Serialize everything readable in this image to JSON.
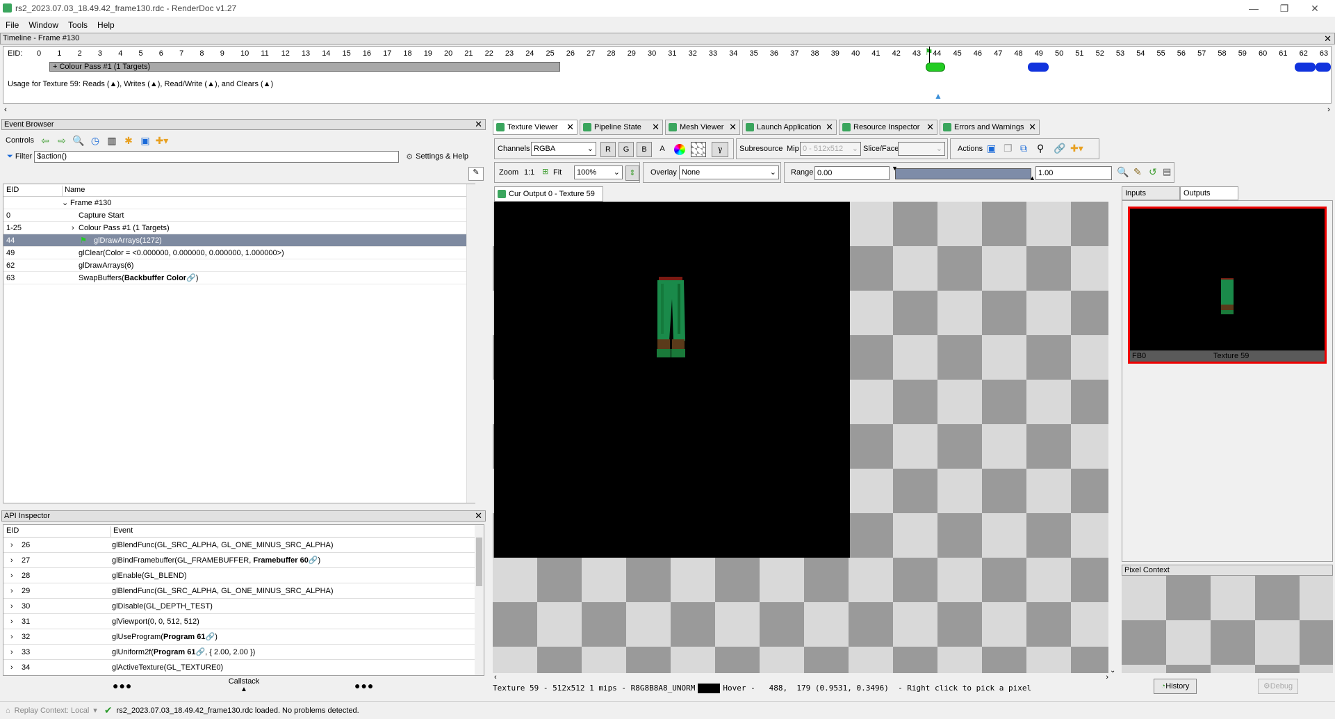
{
  "window": {
    "title": "rs2_2023.07.03_18.49.42_frame130.rdc - RenderDoc v1.27",
    "controls": [
      "—",
      "❐",
      "✕"
    ]
  },
  "menu": [
    "File",
    "Window",
    "Tools",
    "Help"
  ],
  "timeline": {
    "title": "Timeline - Frame #130",
    "eid_label": "EID:",
    "ticks": [
      "0",
      "1",
      "2",
      "3",
      "4",
      "5",
      "6",
      "7",
      "8",
      "9",
      "10",
      "11",
      "12",
      "13",
      "14",
      "15",
      "16",
      "17",
      "18",
      "19",
      "20",
      "21",
      "22",
      "23",
      "24",
      "25",
      "26",
      "27",
      "28",
      "29",
      "30",
      "31",
      "32",
      "33",
      "34",
      "35",
      "36",
      "37",
      "38",
      "39",
      "40",
      "41",
      "42",
      "43",
      "44",
      "45",
      "46",
      "47",
      "48",
      "49",
      "50",
      "51",
      "52",
      "53",
      "54",
      "55",
      "56",
      "57",
      "58",
      "59",
      "60",
      "61",
      "62",
      "63"
    ],
    "current_eid": "44",
    "pass_label": "+ Colour Pass #1 (1 Targets)",
    "usage_text": "Usage for Texture 59: Reads (▲), Writes (▲), Read/Write (▲), and Clears (▲)",
    "colors": {
      "current": "#22cc22",
      "usage": "#1133dd",
      "read": "#ddcc00"
    }
  },
  "event_browser": {
    "title": "Event Browser",
    "controls_label": "Controls",
    "filter_label": "Filter",
    "filter_value": "$action()",
    "settings_label": "Settings & Help",
    "col_eid": "EID",
    "col_name": "Name",
    "rows": [
      {
        "eid": "",
        "name": "Frame #130"
      },
      {
        "eid": "0",
        "name": "Capture Start"
      },
      {
        "eid": "1-25",
        "name": "Colour Pass #1 (1 Targets)"
      },
      {
        "eid": "44",
        "name": "glDrawArrays(1272)"
      },
      {
        "eid": "49",
        "name": "glClear(Color = <0.000000, 0.000000, 0.000000, 1.000000>)"
      },
      {
        "eid": "62",
        "name": "glDrawArrays(6)"
      },
      {
        "eid": "63",
        "name": "SwapBuffers(",
        "bold": "Backbuffer Color"
      }
    ]
  },
  "api_inspector": {
    "title": "API Inspector",
    "col_eid": "EID",
    "col_event": "Event",
    "callstack_label": "Callstack",
    "rows": [
      {
        "eid": "26",
        "event": "glBlendFunc(GL_SRC_ALPHA, GL_ONE_MINUS_SRC_ALPHA)"
      },
      {
        "eid": "27",
        "event": "glBindFramebuffer(GL_FRAMEBUFFER, ",
        "bold": "Framebuffer 60",
        "tail": ")"
      },
      {
        "eid": "28",
        "event": "glEnable(GL_BLEND)"
      },
      {
        "eid": "29",
        "event": "glBlendFunc(GL_SRC_ALPHA, GL_ONE_MINUS_SRC_ALPHA)"
      },
      {
        "eid": "30",
        "event": "glDisable(GL_DEPTH_TEST)"
      },
      {
        "eid": "31",
        "event": "glViewport(0, 0, 512, 512)"
      },
      {
        "eid": "32",
        "event": "glUseProgram(",
        "bold": "Program 61",
        "tail": ")"
      },
      {
        "eid": "33",
        "event": "glUniform2f(",
        "bold": "Program 61",
        "tail": ", { 2.00, 2.00 })"
      },
      {
        "eid": "34",
        "event": "glActiveTexture(GL_TEXTURE0)"
      }
    ]
  },
  "tabs": [
    {
      "label": "Texture Viewer",
      "active": true
    },
    {
      "label": "Pipeline State"
    },
    {
      "label": "Mesh Viewer"
    },
    {
      "label": "Launch Application"
    },
    {
      "label": "Resource Inspector"
    },
    {
      "label": "Errors and Warnings"
    }
  ],
  "texture_viewer": {
    "channels_label": "Channels",
    "channels_value": "RGBA",
    "channel_buttons": [
      "R",
      "G",
      "B",
      "A"
    ],
    "gamma_label": "γ",
    "subresource_label": "Subresource",
    "mip_label": "Mip",
    "mip_value": "0 - 512x512",
    "slice_label": "Slice/Face",
    "actions_label": "Actions",
    "zoom_label": "Zoom",
    "zoom_1to1": "1:1",
    "fit_label": "Fit",
    "zoom_value": "100%",
    "overlay_label": "Overlay",
    "overlay_value": "None",
    "range_label": "Range",
    "range_min": "0.00",
    "range_max": "1.00",
    "output_tab": "Cur Output 0 - Texture 59",
    "status": "Texture 59 - 512x512 1 mips - R8G8B8A8_UNORM",
    "hover": "Hover -   488,  179 (0.9531, 0.3496)  - Right click to pick a pixel"
  },
  "right_panel": {
    "tab_inputs": "Inputs",
    "tab_outputs": "Outputs",
    "thumb_left": "FB0",
    "thumb_right": "Texture 59",
    "pixel_context_title": "Pixel Context",
    "history_label": "History",
    "debug_label": "Debug"
  },
  "status_bar": {
    "replay_label": "Replay Context: Local",
    "message": "rs2_2023.07.03_18.49.42_frame130.rdc loaded. No problems detected."
  }
}
